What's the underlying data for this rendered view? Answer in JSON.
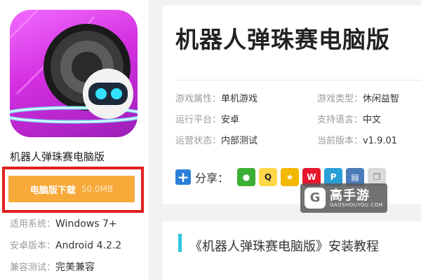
{
  "app": {
    "name": "机器人弹珠赛电脑版",
    "download_label": "电脑版下载",
    "download_size": "50.0MB",
    "info": [
      {
        "label": "适用系统：",
        "value": "Windows 7+"
      },
      {
        "label": "安卓版本：",
        "value": "Android 4.2.2"
      },
      {
        "label": "兼容测试：",
        "value": "完美兼容"
      }
    ]
  },
  "detail": {
    "title": "机器人弹珠赛电脑版",
    "attributes": [
      {
        "label": "游戏属性：",
        "value": "单机游戏"
      },
      {
        "label": "游戏类型：",
        "value": "休闲益智"
      },
      {
        "label": "运行平台：",
        "value": "安卓"
      },
      {
        "label": "支持语言：",
        "value": "中文"
      },
      {
        "label": "运营状态：",
        "value": "内部测试"
      },
      {
        "label": "当前版本：",
        "value": "v1.9.01"
      }
    ],
    "share_label": "分享：",
    "share_icons": [
      "wechat-icon",
      "qq-icon",
      "qzone-icon",
      "weibo-icon",
      "tencent-weibo-icon",
      "print-icon",
      "copy-icon"
    ]
  },
  "watermark": {
    "logo_char": "G",
    "name": "高手游",
    "url": "GAOSHOUYOU.COM"
  },
  "section": {
    "title": "《机器人弹珠赛电脑版》安装教程"
  },
  "colors": {
    "download_button": "#f7a93a",
    "highlight_frame": "#e01f1f",
    "section_accent": "#2fc7e0",
    "share_plus": "#2b80d8"
  }
}
